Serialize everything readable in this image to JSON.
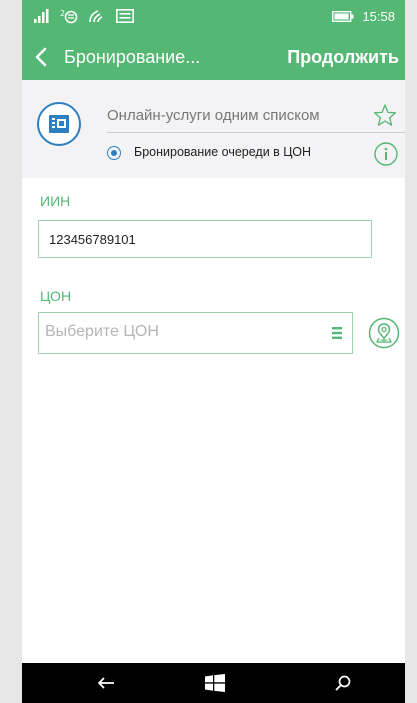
{
  "status_bar": {
    "time": "15:58",
    "icons": [
      "signal-icon",
      "sim-2-icon",
      "wifi-icon",
      "message-icon",
      "battery-icon"
    ]
  },
  "app_bar": {
    "title": "Бронирование...",
    "continue_label": "Продолжить"
  },
  "service": {
    "link_text": "Онлайн-услуги одним списком",
    "selected_option": "Бронирование очереди в ЦОН"
  },
  "form": {
    "iin_label": "ИИН",
    "iin_value": "123456789101",
    "con_label": "ЦОН",
    "con_placeholder": "Выберите ЦОН"
  },
  "nav": {
    "icons": [
      "back-arrow-icon",
      "windows-start-icon",
      "search-icon"
    ]
  },
  "colors": {
    "accent": "#54b774",
    "primary_blue": "#2e7fc1",
    "card_bg": "#f3f3f5"
  }
}
